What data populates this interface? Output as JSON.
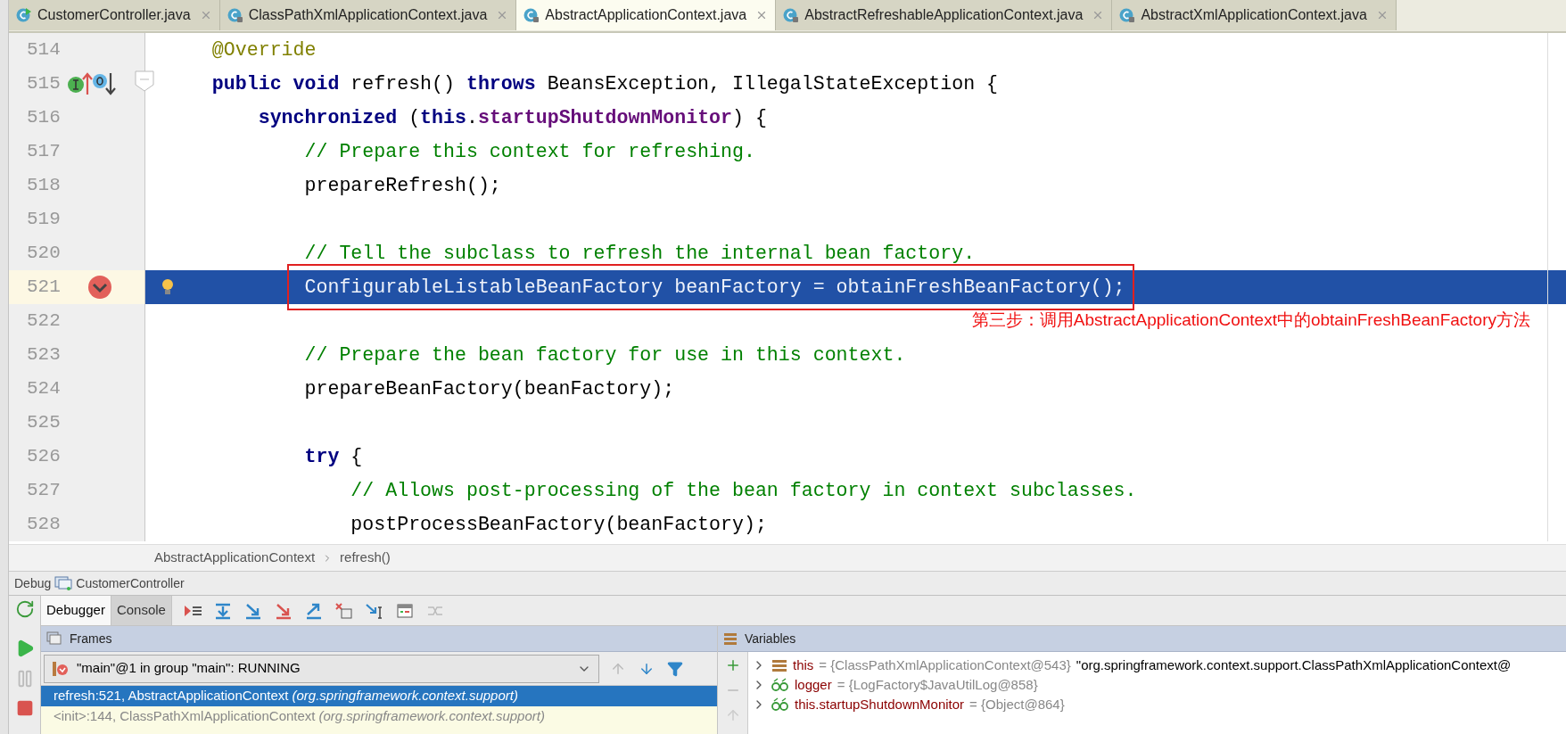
{
  "tabs": [
    {
      "label": "CustomerController.java",
      "kind": "runnable",
      "selected": false
    },
    {
      "label": "ClassPathXmlApplicationContext.java",
      "kind": "locked",
      "selected": false
    },
    {
      "label": "AbstractApplicationContext.java",
      "kind": "locked",
      "selected": true
    },
    {
      "label": "AbstractRefreshableApplicationContext.java",
      "kind": "locked",
      "selected": false
    },
    {
      "label": "AbstractXmlApplicationContext.java",
      "kind": "locked",
      "selected": false
    }
  ],
  "editor": {
    "lines": [
      {
        "number": "514",
        "current": false,
        "breakpoint": false,
        "markers": false,
        "tokens": [
          {
            "text": "    @Override",
            "kind": "annotation"
          }
        ]
      },
      {
        "number": "515",
        "current": false,
        "breakpoint": false,
        "markers": true,
        "tokens": [
          {
            "text": "    public void ",
            "kind": "keyword"
          },
          {
            "text": "refresh() ",
            "kind": "plain"
          },
          {
            "text": "throws ",
            "kind": "keyword"
          },
          {
            "text": "BeansException, IllegalStateException {",
            "kind": "plain"
          }
        ]
      },
      {
        "number": "516",
        "current": false,
        "breakpoint": false,
        "markers": false,
        "tokens": [
          {
            "text": "        synchronized ",
            "kind": "keyword"
          },
          {
            "text": "(",
            "kind": "plain"
          },
          {
            "text": "this",
            "kind": "keyword"
          },
          {
            "text": ".",
            "kind": "plain"
          },
          {
            "text": "startupShutdownMonitor",
            "kind": "field"
          },
          {
            "text": ") {",
            "kind": "plain"
          }
        ]
      },
      {
        "number": "517",
        "current": false,
        "breakpoint": false,
        "markers": false,
        "tokens": [
          {
            "text": "            // Prepare this context for refreshing.",
            "kind": "comment"
          }
        ]
      },
      {
        "number": "518",
        "current": false,
        "breakpoint": false,
        "markers": false,
        "tokens": [
          {
            "text": "            prepareRefresh();",
            "kind": "plain"
          }
        ]
      },
      {
        "number": "519",
        "current": false,
        "breakpoint": false,
        "markers": false
      },
      {
        "number": "520",
        "current": false,
        "breakpoint": false,
        "markers": false,
        "tokens": [
          {
            "text": "            // Tell the subclass to refresh the internal bean factory.",
            "kind": "comment"
          }
        ]
      },
      {
        "number": "521",
        "current": true,
        "breakpoint": true,
        "markers": false,
        "tokens": [
          {
            "text": "            ConfigurableListableBeanFactory beanFactory = obtainFreshBeanFactory();",
            "kind": "framed"
          }
        ]
      },
      {
        "number": "522",
        "current": false,
        "breakpoint": false,
        "markers": false,
        "note": "第三步：调用AbstractApplicationContext中的obtainFreshBeanFactory方法"
      },
      {
        "number": "523",
        "current": false,
        "breakpoint": false,
        "markers": false,
        "tokens": [
          {
            "text": "            // Prepare the bean factory for use in this context.",
            "kind": "comment"
          }
        ]
      },
      {
        "number": "524",
        "current": false,
        "breakpoint": false,
        "markers": false,
        "tokens": [
          {
            "text": "            prepareBeanFactory(beanFactory);",
            "kind": "plain"
          }
        ]
      },
      {
        "number": "525",
        "current": false,
        "breakpoint": false,
        "markers": false
      },
      {
        "number": "526",
        "current": false,
        "breakpoint": false,
        "markers": false,
        "tokens": [
          {
            "text": "            try ",
            "kind": "keyword"
          },
          {
            "text": "{",
            "kind": "plain"
          }
        ]
      },
      {
        "number": "527",
        "current": false,
        "breakpoint": false,
        "markers": false,
        "tokens": [
          {
            "text": "                // Allows post-processing of the bean factory in context subclasses.",
            "kind": "comment"
          }
        ]
      },
      {
        "number": "528",
        "current": false,
        "breakpoint": false,
        "markers": false,
        "tokens": [
          {
            "text": "                postProcessBeanFactory(beanFactory);",
            "kind": "plain"
          }
        ]
      }
    ]
  },
  "breadcrumbs": [
    "AbstractApplicationContext",
    "refresh()"
  ],
  "debug": {
    "title": "Debug",
    "config": "CustomerController",
    "tabs": [
      {
        "label": "Debugger",
        "selected": true
      },
      {
        "label": "Console",
        "selected": false
      }
    ],
    "frames": {
      "title": "Frames",
      "thread": "\"main\"@1 in group \"main\": RUNNING",
      "rows": [
        {
          "method": "refresh:521, AbstractApplicationContext",
          "package": "(org.springframework.context.support)",
          "selected": true
        },
        {
          "method": "<init>:144, ClassPathXmlApplicationContext",
          "package": "(org.springframework.context.support)",
          "selected": false
        }
      ]
    },
    "variables": {
      "title": "Variables",
      "rows": [
        {
          "kind": "field",
          "name": "this",
          "value": "= {ClassPathXmlApplicationContext@543}",
          "text": "\"org.springframework.context.support.ClassPathXmlApplicationContext@"
        },
        {
          "kind": "watch",
          "name": "logger",
          "value": "= {LogFactory$JavaUtilLog@858}"
        },
        {
          "kind": "watch",
          "name": "this.startupShutdownMonitor",
          "value": "= {Object@864}"
        }
      ]
    }
  }
}
